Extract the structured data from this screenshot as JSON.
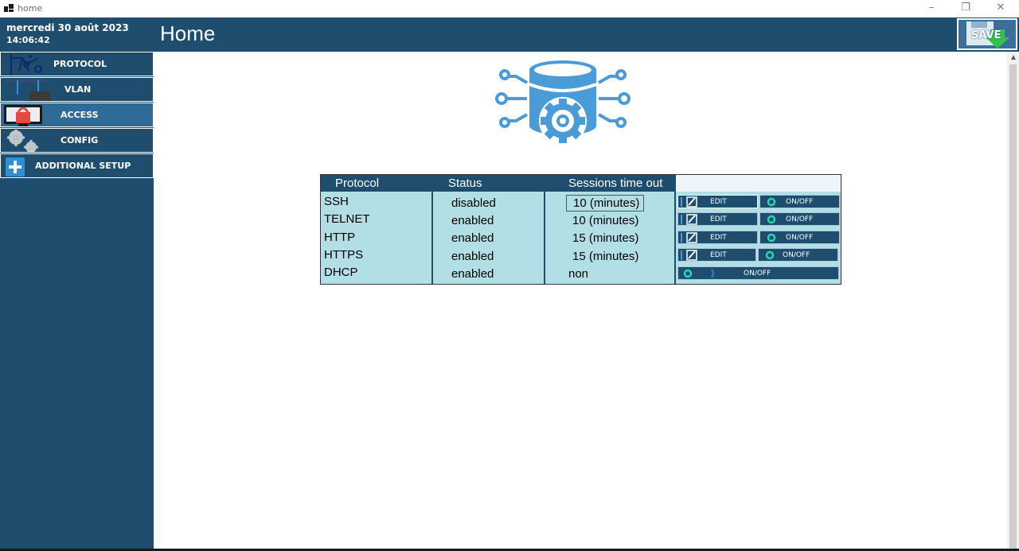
{
  "window": {
    "title": "home"
  },
  "sidebar": {
    "date": "mercredi 30 août 2023",
    "time": "14:06:42",
    "items": [
      {
        "label": "PROTOCOL",
        "icon": "network-icon"
      },
      {
        "label": "VLAN",
        "icon": "switch-icon"
      },
      {
        "label": "ACCESS",
        "icon": "monitor-lock-icon"
      },
      {
        "label": "CONFIG",
        "icon": "gears-icon"
      },
      {
        "label": "ADDITIONAL SETUP",
        "icon": "plus-icon"
      }
    ]
  },
  "header": {
    "title": "Home",
    "save_label": "SAVE"
  },
  "table": {
    "columns": [
      "Protocol",
      "Status",
      "Sessions time out"
    ],
    "rows": [
      {
        "protocol": "SSH",
        "status": "disabled",
        "timeout": "10 (minutes)"
      },
      {
        "protocol": "TELNET",
        "status": "enabled",
        "timeout": "10 (minutes)"
      },
      {
        "protocol": "HTTP",
        "status": "enabled",
        "timeout": "15 (minutes)"
      },
      {
        "protocol": "HTTPS",
        "status": "enabled",
        "timeout": "15 (minutes)"
      },
      {
        "protocol": "DHCP",
        "status": "enabled",
        "timeout": "non"
      }
    ],
    "edit_label": "EDIT",
    "toggle_label": "ON/OFF"
  },
  "colors": {
    "primary": "#1e4d6e",
    "active": "#2e6b97",
    "table_bg": "#b2dfe5",
    "icon_blue": "#4a9bd6"
  }
}
